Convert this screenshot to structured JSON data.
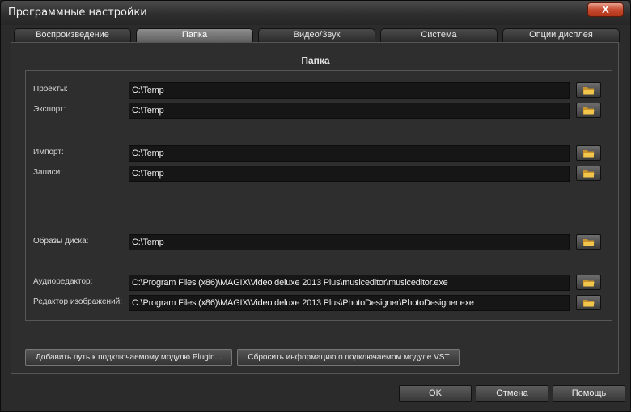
{
  "window": {
    "title": "Программные настройки",
    "close_glyph": "X"
  },
  "tabs": [
    {
      "label": "Воспроизведение"
    },
    {
      "label": "Папка"
    },
    {
      "label": "Видео/Звук"
    },
    {
      "label": "Система"
    },
    {
      "label": "Опции дисплея"
    }
  ],
  "panel": {
    "title": "Папка",
    "rows": [
      {
        "label": "Проекты:",
        "value": "C:\\Temp"
      },
      {
        "label": "Экспорт:",
        "value": "C:\\Temp"
      },
      {
        "label": "Импорт:",
        "value": "C:\\Temp"
      },
      {
        "label": "Записи:",
        "value": "C:\\Temp"
      },
      {
        "label": "Образы диска:",
        "value": "C:\\Temp"
      },
      {
        "label": "Аудиоредактор:",
        "value": "C:\\Program Files (x86)\\MAGIX\\Video deluxe 2013 Plus\\musiceditor\\musiceditor.exe"
      },
      {
        "label": "Редактор изображений:",
        "value": "C:\\Program Files (x86)\\MAGIX\\Video deluxe 2013 Plus\\PhotoDesigner\\PhotoDesigner.exe"
      }
    ]
  },
  "plugin_buttons": {
    "add_path": "Добавить путь к подключаемому модулю Plugin...",
    "reset_vst": "Сбросить информацию о подключаемом модуле VST"
  },
  "footer": {
    "ok": "OK",
    "cancel": "Отмена",
    "help": "Помощь"
  },
  "icons": {
    "browse": "folder-icon",
    "folder_color": "#f2c64a"
  }
}
